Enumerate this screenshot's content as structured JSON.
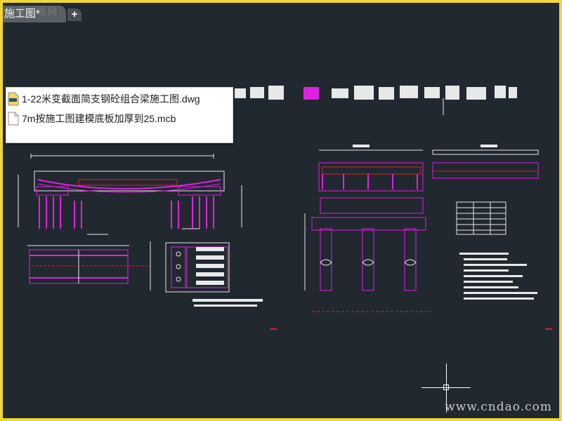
{
  "tab": {
    "title": "施工图*",
    "add_label": "+"
  },
  "watermark_top": "百度建筑网",
  "recent_files": [
    {
      "name": "1-22米变截面简支钢砼组合梁施工图.dwg",
      "icon": "dwg-file-icon"
    },
    {
      "name": "7m按施工图建模底板加厚到25.mcb",
      "icon": "blank-file-icon"
    }
  ],
  "watermark_bottom": "www.cndao.com",
  "colors": {
    "frame": "#f2d635",
    "canvas_bg": "#212830",
    "line_white": "#e8e8e8",
    "line_magenta": "#e020e0",
    "line_red": "#e02020"
  }
}
